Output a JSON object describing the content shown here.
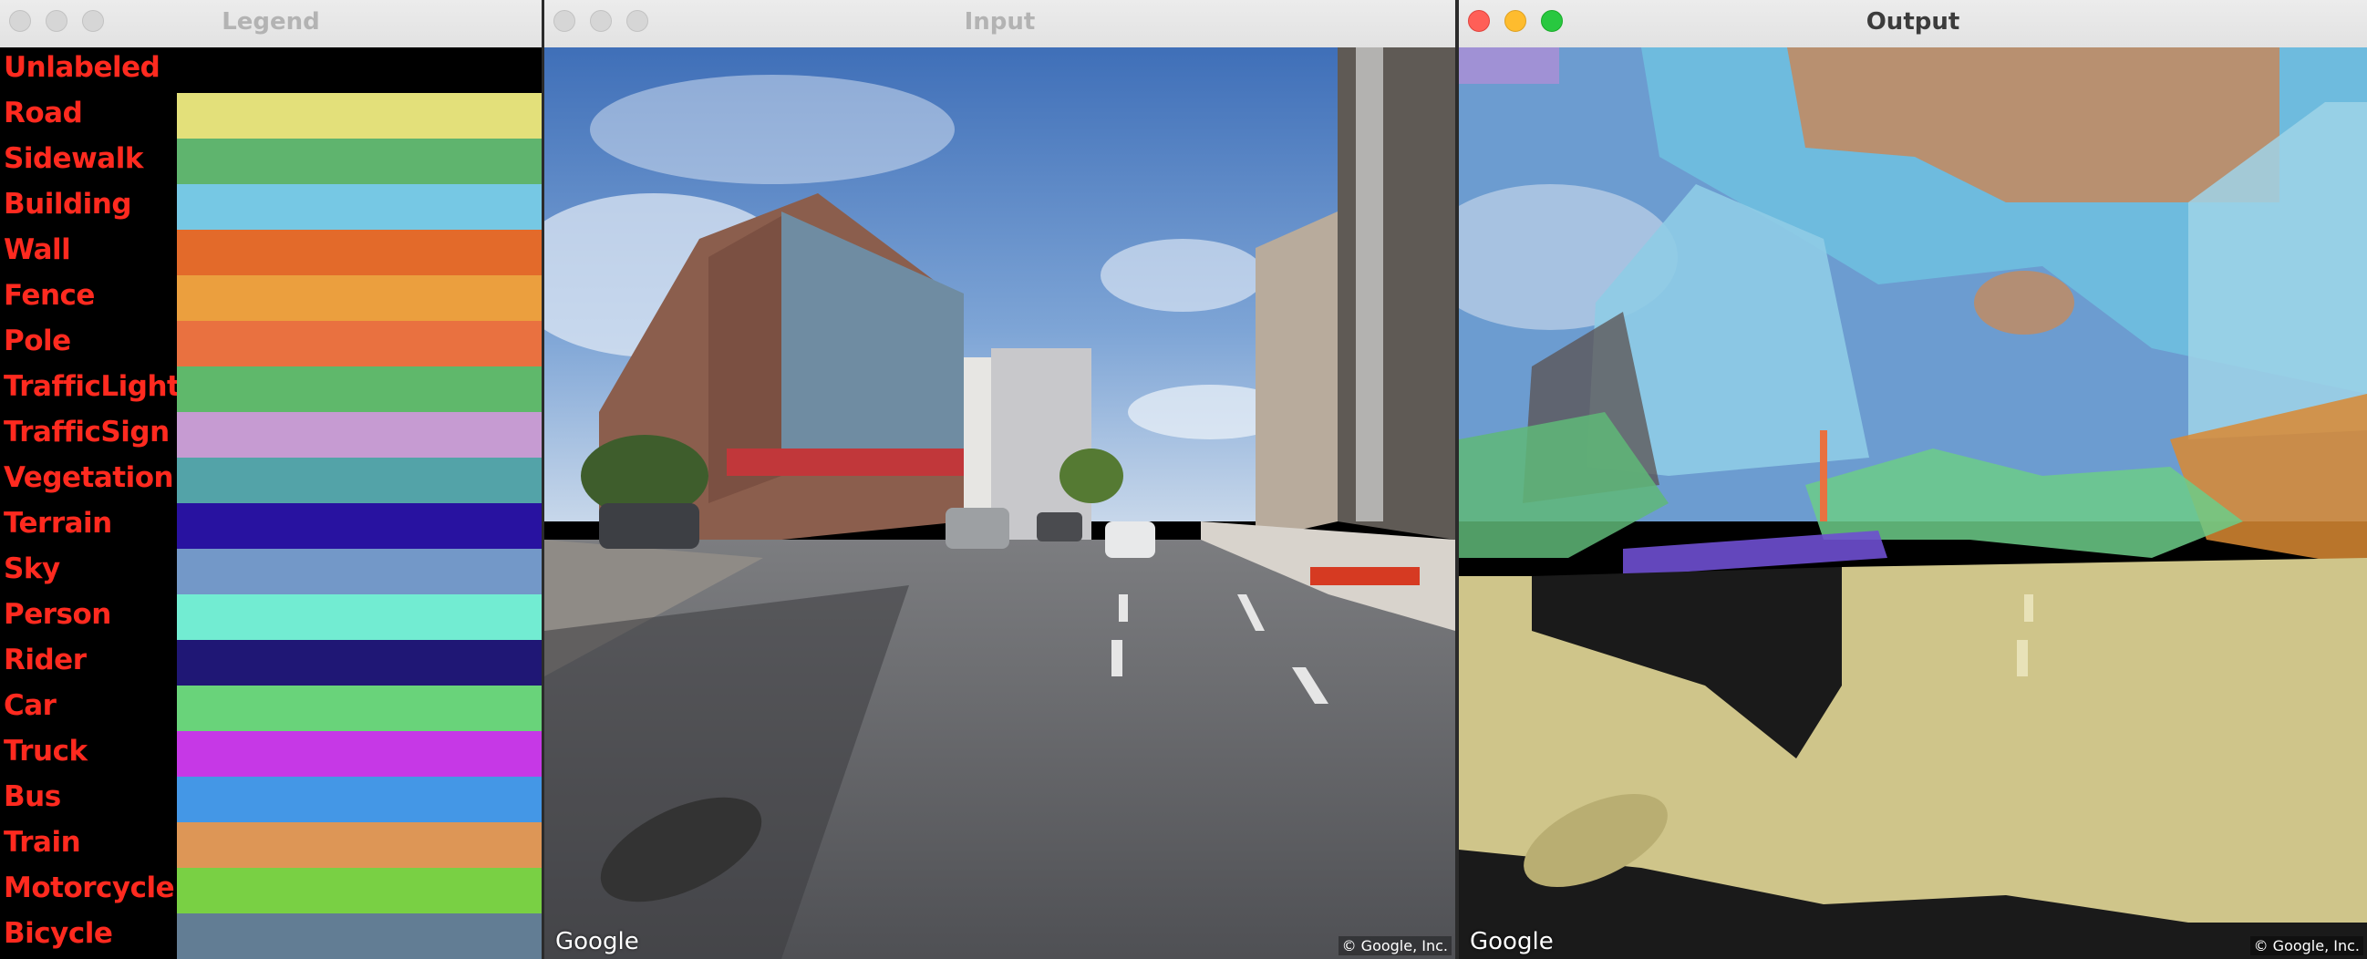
{
  "windows": {
    "legend": {
      "title": "Legend"
    },
    "input": {
      "title": "Input"
    },
    "output": {
      "title": "Output"
    }
  },
  "legend": {
    "label_color": "#ff2a1f",
    "classes": [
      {
        "label": "Unlabeled",
        "color": "#000000"
      },
      {
        "label": "Road",
        "color": "#e3e07a"
      },
      {
        "label": "Sidewalk",
        "color": "#5fb46e"
      },
      {
        "label": "Building",
        "color": "#76c8e4"
      },
      {
        "label": "Wall",
        "color": "#e36a2a"
      },
      {
        "label": "Fence",
        "color": "#eb9f3e"
      },
      {
        "label": "Pole",
        "color": "#e97140"
      },
      {
        "label": "TrafficLight",
        "color": "#5fb86b"
      },
      {
        "label": "TrafficSign",
        "color": "#c69bd2"
      },
      {
        "label": "Vegetation",
        "color": "#53a3a8"
      },
      {
        "label": "Terrain",
        "color": "#2812a0"
      },
      {
        "label": "Sky",
        "color": "#7398c8"
      },
      {
        "label": "Person",
        "color": "#72ecd2"
      },
      {
        "label": "Rider",
        "color": "#1f1775"
      },
      {
        "label": "Car",
        "color": "#69d37a"
      },
      {
        "label": "Truck",
        "color": "#c638e6"
      },
      {
        "label": "Bus",
        "color": "#4497e6"
      },
      {
        "label": "Train",
        "color": "#dd9656"
      },
      {
        "label": "Motorcycle",
        "color": "#79d044"
      },
      {
        "label": "Bicycle",
        "color": "#627d94"
      }
    ]
  },
  "input_image": {
    "watermark": "Google",
    "copyright": "© Google, Inc."
  },
  "output_image": {
    "watermark": "Google",
    "copyright": "© Google, Inc."
  },
  "icons": {
    "close": "close-button-icon",
    "minimize": "minimize-button-icon",
    "zoom": "zoom-button-icon"
  }
}
